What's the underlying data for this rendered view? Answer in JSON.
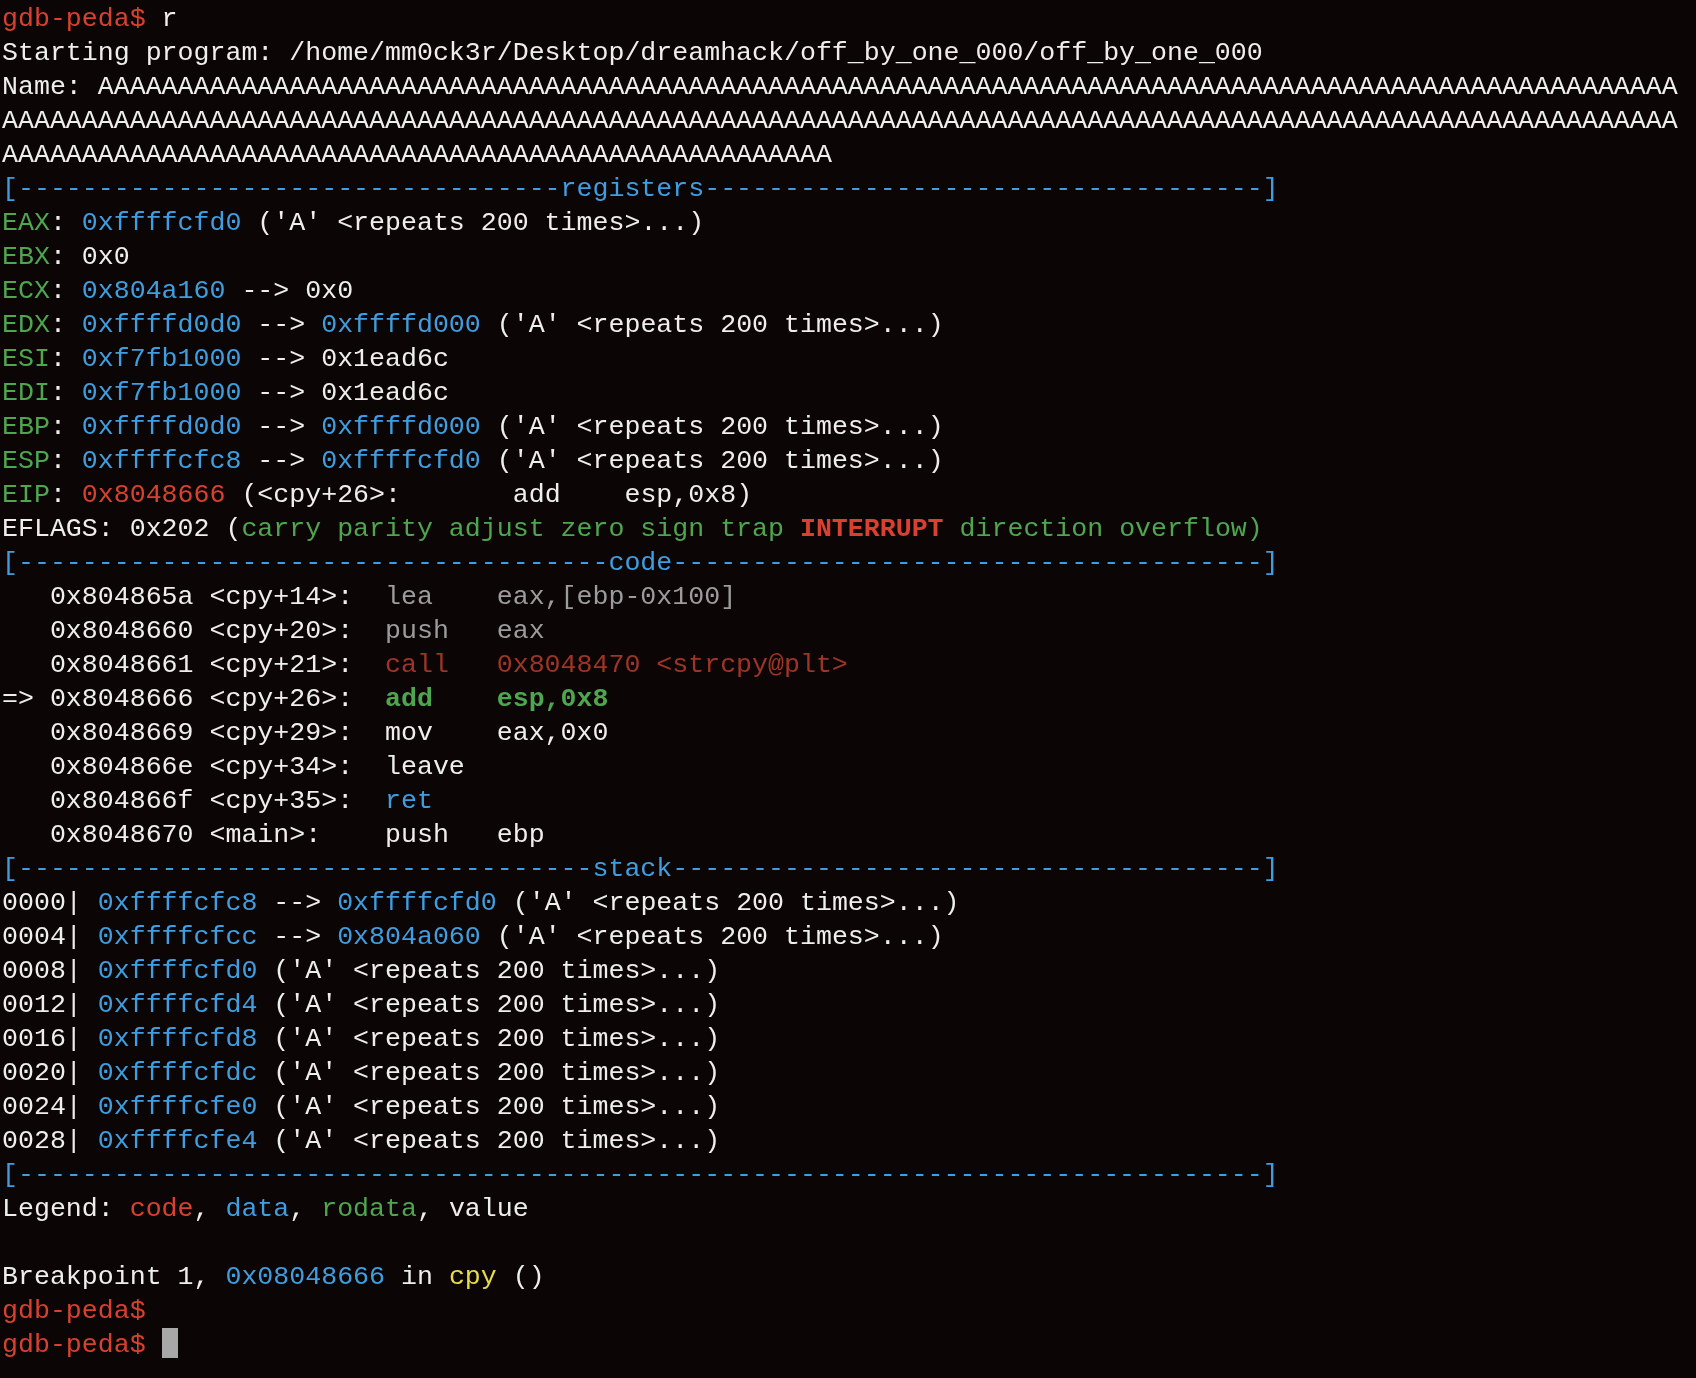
{
  "terminal": {
    "cursor_visible": true,
    "lines": [
      {
        "kind": "text",
        "segments": [
          {
            "text": "gdb-peda$ ",
            "color": "#d8412f"
          },
          {
            "text": "r",
            "color": "#eeeeec"
          }
        ]
      },
      {
        "kind": "text",
        "segments": [
          {
            "text": "Starting program: /home/mm0ck3r/Desktop/dreamhack/off_by_one_000/off_by_one_000",
            "color": "#eeeeec"
          }
        ]
      },
      {
        "kind": "text",
        "segments": [
          {
            "text": "Name: AAAAAAAAAAAAAAAAAAAAAAAAAAAAAAAAAAAAAAAAAAAAAAAAAAAAAAAAAAAAAAAAAAAAAAAAAAAAAAAAAAAAAAAAAAAAAAAAAAA",
            "color": "#eeeeec"
          }
        ]
      },
      {
        "kind": "text",
        "segments": [
          {
            "text": "AAAAAAAAAAAAAAAAAAAAAAAAAAAAAAAAAAAAAAAAAAAAAAAAAAAAAAAAAAAAAAAAAAAAAAAAAAAAAAAAAAAAAAAAAAAAAAAAAAAAAAAAA",
            "color": "#eeeeec"
          }
        ]
      },
      {
        "kind": "text",
        "segments": [
          {
            "text": "AAAAAAAAAAAAAAAAAAAAAAAAAAAAAAAAAAAAAAAAAAAAAAAAAAAA",
            "color": "#eeeeec"
          }
        ]
      },
      {
        "kind": "text",
        "segments": [
          {
            "text": "[----------------------------------registers-----------------------------------]",
            "color": "#3f9ee0"
          }
        ]
      },
      {
        "kind": "text",
        "segments": [
          {
            "text": "EAX",
            "color": "#4ea64e"
          },
          {
            "text": ": ",
            "color": "#eeeeec"
          },
          {
            "text": "0xffffcfd0",
            "color": "#3f9ee0"
          },
          {
            "text": " ('A' <repeats 200 times>...)",
            "color": "#eeeeec"
          }
        ]
      },
      {
        "kind": "text",
        "segments": [
          {
            "text": "EBX",
            "color": "#4ea64e"
          },
          {
            "text": ": 0x0",
            "color": "#eeeeec"
          }
        ]
      },
      {
        "kind": "text",
        "segments": [
          {
            "text": "ECX",
            "color": "#4ea64e"
          },
          {
            "text": ": ",
            "color": "#eeeeec"
          },
          {
            "text": "0x804a160",
            "color": "#3f9ee0"
          },
          {
            "text": " --> 0x0",
            "color": "#eeeeec"
          }
        ]
      },
      {
        "kind": "text",
        "segments": [
          {
            "text": "EDX",
            "color": "#4ea64e"
          },
          {
            "text": ": ",
            "color": "#eeeeec"
          },
          {
            "text": "0xffffd0d0",
            "color": "#3f9ee0"
          },
          {
            "text": " --> ",
            "color": "#eeeeec"
          },
          {
            "text": "0xffffd000",
            "color": "#3f9ee0"
          },
          {
            "text": " ('A' <repeats 200 times>...)",
            "color": "#eeeeec"
          }
        ]
      },
      {
        "kind": "text",
        "segments": [
          {
            "text": "ESI",
            "color": "#4ea64e"
          },
          {
            "text": ": ",
            "color": "#eeeeec"
          },
          {
            "text": "0xf7fb1000",
            "color": "#3f9ee0"
          },
          {
            "text": " --> 0x1ead6c",
            "color": "#eeeeec"
          }
        ]
      },
      {
        "kind": "text",
        "segments": [
          {
            "text": "EDI",
            "color": "#4ea64e"
          },
          {
            "text": ": ",
            "color": "#eeeeec"
          },
          {
            "text": "0xf7fb1000",
            "color": "#3f9ee0"
          },
          {
            "text": " --> 0x1ead6c",
            "color": "#eeeeec"
          }
        ]
      },
      {
        "kind": "text",
        "segments": [
          {
            "text": "EBP",
            "color": "#4ea64e"
          },
          {
            "text": ": ",
            "color": "#eeeeec"
          },
          {
            "text": "0xffffd0d0",
            "color": "#3f9ee0"
          },
          {
            "text": " --> ",
            "color": "#eeeeec"
          },
          {
            "text": "0xffffd000",
            "color": "#3f9ee0"
          },
          {
            "text": " ('A' <repeats 200 times>...)",
            "color": "#eeeeec"
          }
        ]
      },
      {
        "kind": "text",
        "segments": [
          {
            "text": "ESP",
            "color": "#4ea64e"
          },
          {
            "text": ": ",
            "color": "#eeeeec"
          },
          {
            "text": "0xffffcfc8",
            "color": "#3f9ee0"
          },
          {
            "text": " --> ",
            "color": "#eeeeec"
          },
          {
            "text": "0xffffcfd0",
            "color": "#3f9ee0"
          },
          {
            "text": " ('A' <repeats 200 times>...)",
            "color": "#eeeeec"
          }
        ]
      },
      {
        "kind": "text",
        "segments": [
          {
            "text": "EIP",
            "color": "#4ea64e"
          },
          {
            "text": ": ",
            "color": "#eeeeec"
          },
          {
            "text": "0x8048666",
            "color": "#d8412f"
          },
          {
            "text": " (<cpy+26>:       add    esp,0x8)",
            "color": "#eeeeec"
          }
        ]
      },
      {
        "kind": "text",
        "segments": [
          {
            "text": "EFLAGS: 0x202 (",
            "color": "#eeeeec"
          },
          {
            "text": "carry parity adjust zero sign trap ",
            "color": "#4ea64e"
          },
          {
            "text": "**INTERRUPT**",
            "color": "#d8412f"
          },
          {
            "text": " direction overflow)",
            "color": "#4ea64e"
          }
        ]
      },
      {
        "kind": "text",
        "segments": [
          {
            "text": "[-------------------------------------code-------------------------------------]",
            "color": "#3f9ee0"
          }
        ]
      },
      {
        "kind": "text",
        "segments": [
          {
            "text": "   0x804865a <cpy+14>:  ",
            "color": "#eeeeec"
          },
          {
            "text": "lea    eax,[ebp-0x100]",
            "color": "#9c9c9c"
          }
        ]
      },
      {
        "kind": "text",
        "segments": [
          {
            "text": "   0x8048660 <cpy+20>:  ",
            "color": "#eeeeec"
          },
          {
            "text": "push   eax",
            "color": "#9c9c9c"
          }
        ]
      },
      {
        "kind": "text",
        "segments": [
          {
            "text": "   0x8048661 <cpy+21>:  ",
            "color": "#eeeeec"
          },
          {
            "text": "call   0x8048470 <strcpy@plt>",
            "color": "#9e3526"
          }
        ]
      },
      {
        "kind": "text",
        "segments": [
          {
            "text": "=> 0x8048666 <cpy+26>:  ",
            "color": "#eeeeec"
          },
          {
            "text": "**add    esp,0x8**",
            "color": "#4ea64e"
          }
        ]
      },
      {
        "kind": "text",
        "segments": [
          {
            "text": "   0x8048669 <cpy+29>:  mov    eax,0x0",
            "color": "#eeeeec"
          }
        ]
      },
      {
        "kind": "text",
        "segments": [
          {
            "text": "   0x804866e <cpy+34>:  leave",
            "color": "#eeeeec"
          }
        ]
      },
      {
        "kind": "text",
        "segments": [
          {
            "text": "   0x804866f <cpy+35>:  ",
            "color": "#eeeeec"
          },
          {
            "text": "ret",
            "color": "#3f9ee0"
          }
        ]
      },
      {
        "kind": "text",
        "segments": [
          {
            "text": "   0x8048670 <main>:    push   ebp",
            "color": "#eeeeec"
          }
        ]
      },
      {
        "kind": "text",
        "segments": [
          {
            "text": "[------------------------------------stack-------------------------------------]",
            "color": "#3f9ee0"
          }
        ]
      },
      {
        "kind": "text",
        "segments": [
          {
            "text": "0000| ",
            "color": "#eeeeec"
          },
          {
            "text": "0xffffcfc8",
            "color": "#3f9ee0"
          },
          {
            "text": " --> ",
            "color": "#eeeeec"
          },
          {
            "text": "0xffffcfd0",
            "color": "#3f9ee0"
          },
          {
            "text": " ('A' <repeats 200 times>...)",
            "color": "#eeeeec"
          }
        ]
      },
      {
        "kind": "text",
        "segments": [
          {
            "text": "0004| ",
            "color": "#eeeeec"
          },
          {
            "text": "0xffffcfcc",
            "color": "#3f9ee0"
          },
          {
            "text": " --> ",
            "color": "#eeeeec"
          },
          {
            "text": "0x804a060",
            "color": "#3f9ee0"
          },
          {
            "text": " ('A' <repeats 200 times>...)",
            "color": "#eeeeec"
          }
        ]
      },
      {
        "kind": "text",
        "segments": [
          {
            "text": "0008| ",
            "color": "#eeeeec"
          },
          {
            "text": "0xffffcfd0",
            "color": "#3f9ee0"
          },
          {
            "text": " ('A' <repeats 200 times>...)",
            "color": "#eeeeec"
          }
        ]
      },
      {
        "kind": "text",
        "segments": [
          {
            "text": "0012| ",
            "color": "#eeeeec"
          },
          {
            "text": "0xffffcfd4",
            "color": "#3f9ee0"
          },
          {
            "text": " ('A' <repeats 200 times>...)",
            "color": "#eeeeec"
          }
        ]
      },
      {
        "kind": "text",
        "segments": [
          {
            "text": "0016| ",
            "color": "#eeeeec"
          },
          {
            "text": "0xffffcfd8",
            "color": "#3f9ee0"
          },
          {
            "text": " ('A' <repeats 200 times>...)",
            "color": "#eeeeec"
          }
        ]
      },
      {
        "kind": "text",
        "segments": [
          {
            "text": "0020| ",
            "color": "#eeeeec"
          },
          {
            "text": "0xffffcfdc",
            "color": "#3f9ee0"
          },
          {
            "text": " ('A' <repeats 200 times>...)",
            "color": "#eeeeec"
          }
        ]
      },
      {
        "kind": "text",
        "segments": [
          {
            "text": "0024| ",
            "color": "#eeeeec"
          },
          {
            "text": "0xffffcfe0",
            "color": "#3f9ee0"
          },
          {
            "text": " ('A' <repeats 200 times>...)",
            "color": "#eeeeec"
          }
        ]
      },
      {
        "kind": "text",
        "segments": [
          {
            "text": "0028| ",
            "color": "#eeeeec"
          },
          {
            "text": "0xffffcfe4",
            "color": "#3f9ee0"
          },
          {
            "text": " ('A' <repeats 200 times>...)",
            "color": "#eeeeec"
          }
        ]
      },
      {
        "kind": "text",
        "segments": [
          {
            "text": "[------------------------------------------------------------------------------]",
            "color": "#3f9ee0"
          }
        ]
      },
      {
        "kind": "text",
        "segments": [
          {
            "text": "Legend: ",
            "color": "#eeeeec"
          },
          {
            "text": "code",
            "color": "#d8412f"
          },
          {
            "text": ", ",
            "color": "#eeeeec"
          },
          {
            "text": "data",
            "color": "#3f9ee0"
          },
          {
            "text": ", ",
            "color": "#eeeeec"
          },
          {
            "text": "rodata",
            "color": "#4ea64e"
          },
          {
            "text": ", value",
            "color": "#eeeeec"
          }
        ]
      },
      {
        "kind": "blank"
      },
      {
        "kind": "text",
        "segments": [
          {
            "text": "Breakpoint 1, ",
            "color": "#eeeeec"
          },
          {
            "text": "0x08048666",
            "color": "#3f9ee0"
          },
          {
            "text": " in ",
            "color": "#eeeeec"
          },
          {
            "text": "cpy",
            "color": "#e5dc4c"
          },
          {
            "text": " ()",
            "color": "#eeeeec"
          }
        ]
      },
      {
        "kind": "text",
        "segments": [
          {
            "text": "gdb-peda$",
            "color": "#d8412f"
          }
        ]
      },
      {
        "kind": "text",
        "segments": [
          {
            "text": "gdb-peda$ ",
            "color": "#d8412f"
          }
        ]
      }
    ]
  }
}
